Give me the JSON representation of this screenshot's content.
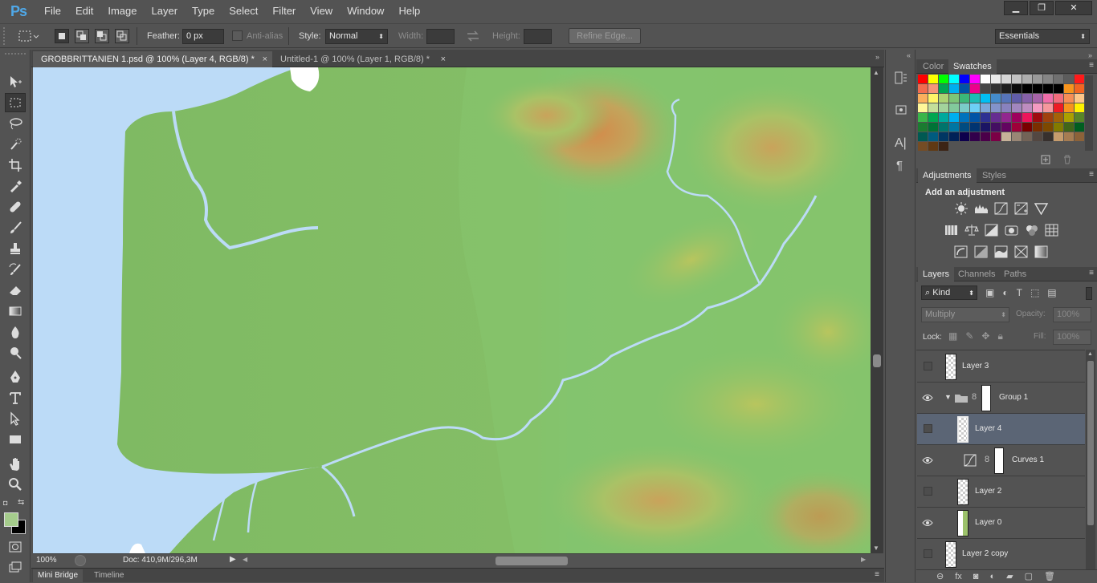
{
  "app": {
    "logo": "Ps"
  },
  "menu": [
    "File",
    "Edit",
    "Image",
    "Layer",
    "Type",
    "Select",
    "Filter",
    "View",
    "Window",
    "Help"
  ],
  "window_controls": {
    "minimize": "▁",
    "restore": "❐",
    "close": "✕"
  },
  "options": {
    "feather_label": "Feather:",
    "feather_value": "0 px",
    "antialias_label": "Anti-alias",
    "style_label": "Style:",
    "style_value": "Normal",
    "width_label": "Width:",
    "height_label": "Height:",
    "refine_edge": "Refine Edge...",
    "workspace": "Essentials"
  },
  "tabs": [
    {
      "label": "GROBBRITTANIEN 1.psd @ 100% (Layer 4, RGB/8) *",
      "close": "×"
    },
    {
      "label": "Untitled-1 @ 100% (Layer 1, RGB/8) *",
      "close": "×"
    }
  ],
  "status": {
    "zoom": "100%",
    "doc": "Doc: 410,9M/296,3M"
  },
  "bottom_tabs": [
    "Mini Bridge",
    "Timeline"
  ],
  "color_panel": {
    "tabs": [
      "Color",
      "Swatches"
    ]
  },
  "swatch_rows": [
    [
      "#ff0000",
      "#ffff00",
      "#00ff00",
      "#00ffff",
      "#0000ff",
      "#ff00ff",
      "#ffffff",
      "#ebebeb",
      "#d6d6d6",
      "#c2c2c2",
      "#adadad",
      "#999999",
      "#858585",
      "#707070",
      "#5c5c5c",
      "#ff1a1a"
    ],
    [
      "#f26c4f",
      "#f69679",
      "#00a651",
      "#00aeef",
      "#0054a6",
      "#ec008c",
      "#474747",
      "#333333",
      "#1f1f1f",
      "#0a0a0a",
      "#000000",
      "#000000",
      "#000000",
      "#000000",
      "#f7941d",
      "#f26522"
    ],
    [
      "#fbaf5d",
      "#fff568",
      "#acd373",
      "#7cc576",
      "#3bb878",
      "#1cbbb4",
      "#00bff3",
      "#448ccb",
      "#5674b9",
      "#605ca8",
      "#8560a8",
      "#a763a8",
      "#f06eaa",
      "#f26d7d",
      "#f68e56",
      "#fdc689"
    ],
    [
      "#fff799",
      "#c4df9b",
      "#a3d39c",
      "#82ca9c",
      "#7accc8",
      "#6dcff6",
      "#7da7d9",
      "#8393ca",
      "#8882be",
      "#a186be",
      "#bd8cbf",
      "#f49ac1",
      "#f5989d",
      "#ed1c24",
      "#f7941d",
      "#fff200"
    ],
    [
      "#39b54a",
      "#00a651",
      "#00a99d",
      "#00aeef",
      "#0072bc",
      "#0054a6",
      "#2e3192",
      "#662d91",
      "#92278f",
      "#9e005d",
      "#ed145b",
      "#9e0b0f",
      "#a0410d",
      "#a36209",
      "#aba000",
      "#598527"
    ],
    [
      "#1a7b30",
      "#007236",
      "#00746b",
      "#0076a3",
      "#004b80",
      "#003471",
      "#1b1464",
      "#440e62",
      "#630460",
      "#9e0039",
      "#790000",
      "#7b2e00",
      "#7d4900",
      "#827b00",
      "#406618",
      "#005e20"
    ],
    [
      "#005952",
      "#005b7f",
      "#003663",
      "#002157",
      "#0d004c",
      "#32004b",
      "#4b0049",
      "#7b0046",
      "#c7b299",
      "#998675",
      "#736357",
      "#534741",
      "#37302d",
      "#c69c6d",
      "#a67c52",
      "#8c6239"
    ],
    [
      "#754c24",
      "#603913",
      "#3c2415"
    ]
  ],
  "adjustments": {
    "tabs": [
      "Adjustments",
      "Styles"
    ],
    "title": "Add an adjustment"
  },
  "layers_panel": {
    "tabs": [
      "Layers",
      "Channels",
      "Paths"
    ],
    "filter": "Kind",
    "blend": "Multiply",
    "opacity_label": "Opacity:",
    "opacity": "100%",
    "lock_label": "Lock:",
    "fill_label": "Fill:",
    "fill": "100%",
    "layers": [
      {
        "name": "Layer 3",
        "visible": false,
        "selected": false
      },
      {
        "name": "Group 1",
        "visible": true,
        "selected": false,
        "group": true
      },
      {
        "name": "Layer 4",
        "visible": false,
        "selected": true
      },
      {
        "name": "Curves 1",
        "visible": true,
        "selected": false,
        "adjustment": true
      },
      {
        "name": "Layer 2",
        "visible": false,
        "selected": false
      },
      {
        "name": "Layer 0",
        "visible": true,
        "selected": false
      },
      {
        "name": "Layer 2 copy",
        "visible": false,
        "selected": false
      }
    ]
  }
}
